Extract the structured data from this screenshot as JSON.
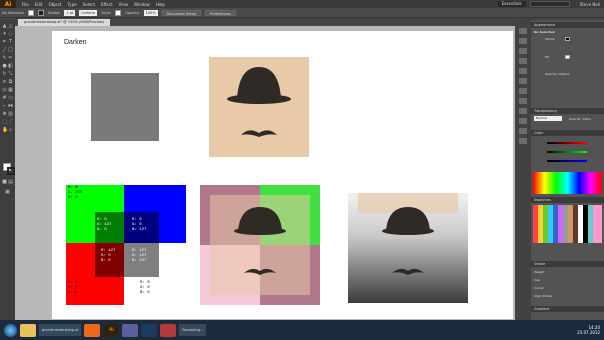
{
  "app": {
    "logo": "Ai",
    "menu": [
      "File",
      "Edit",
      "Object",
      "Type",
      "Select",
      "Effect",
      "View",
      "Window",
      "Help"
    ],
    "workspace": "Essentials",
    "user": "Steve Neil"
  },
  "controlbar": {
    "selection": "No Selection",
    "stroke_label": "Stroke:",
    "stroke_value": "1 pt",
    "uniform": "Uniform",
    "style_label": "Style:",
    "opacity_label": "Opacity:",
    "opacity_value": "100%",
    "document_setup": "Document Setup",
    "preferences": "Preferences"
  },
  "doctab": {
    "label": "grandmesterstexp.ai* @ 150% (RGB/Preview)"
  },
  "artboard": {
    "title": "Darken",
    "labels": {
      "green": "R: 0\nG: 255\nB: 0",
      "dark_green": "R: 0\nG: 127\nB: 0",
      "dark_blue": "R: 0\nG: 0\nB: 127",
      "dark_red": "R: 127\nG: 0\nB: 0",
      "gray": "R: 127\nG: 127\nB: 127",
      "red": "R: 0\nG: 0\nB: 0",
      "black": "R: 0\nG: 0\nB: 0"
    }
  },
  "panels": {
    "appearance_title": "Appearance",
    "appearance_sub": "No Selection",
    "appearance_rows": [
      "Stroke",
      "Fill",
      "Opacity: Default"
    ],
    "transparency_title": "Transparency",
    "blend_mode": "Normal",
    "opacity": "Opacity: 100%",
    "color_title": "Color",
    "swatches_title": "Swatches",
    "stroke_title": "Stroke",
    "stroke_rows": [
      "Weight",
      "Cap",
      "Corner",
      "Align Stroke"
    ],
    "gradient_title": "Gradient"
  },
  "taskbar": {
    "tasks": [
      "grandmesterstexp.ai",
      "Recording..."
    ],
    "time": "14:20",
    "date": "25.07.2012"
  },
  "colors": {
    "accent": "#ff9a00",
    "skin": "#e8c9a8",
    "hat": "#2f2a26",
    "pink": "#f5c8d8"
  }
}
